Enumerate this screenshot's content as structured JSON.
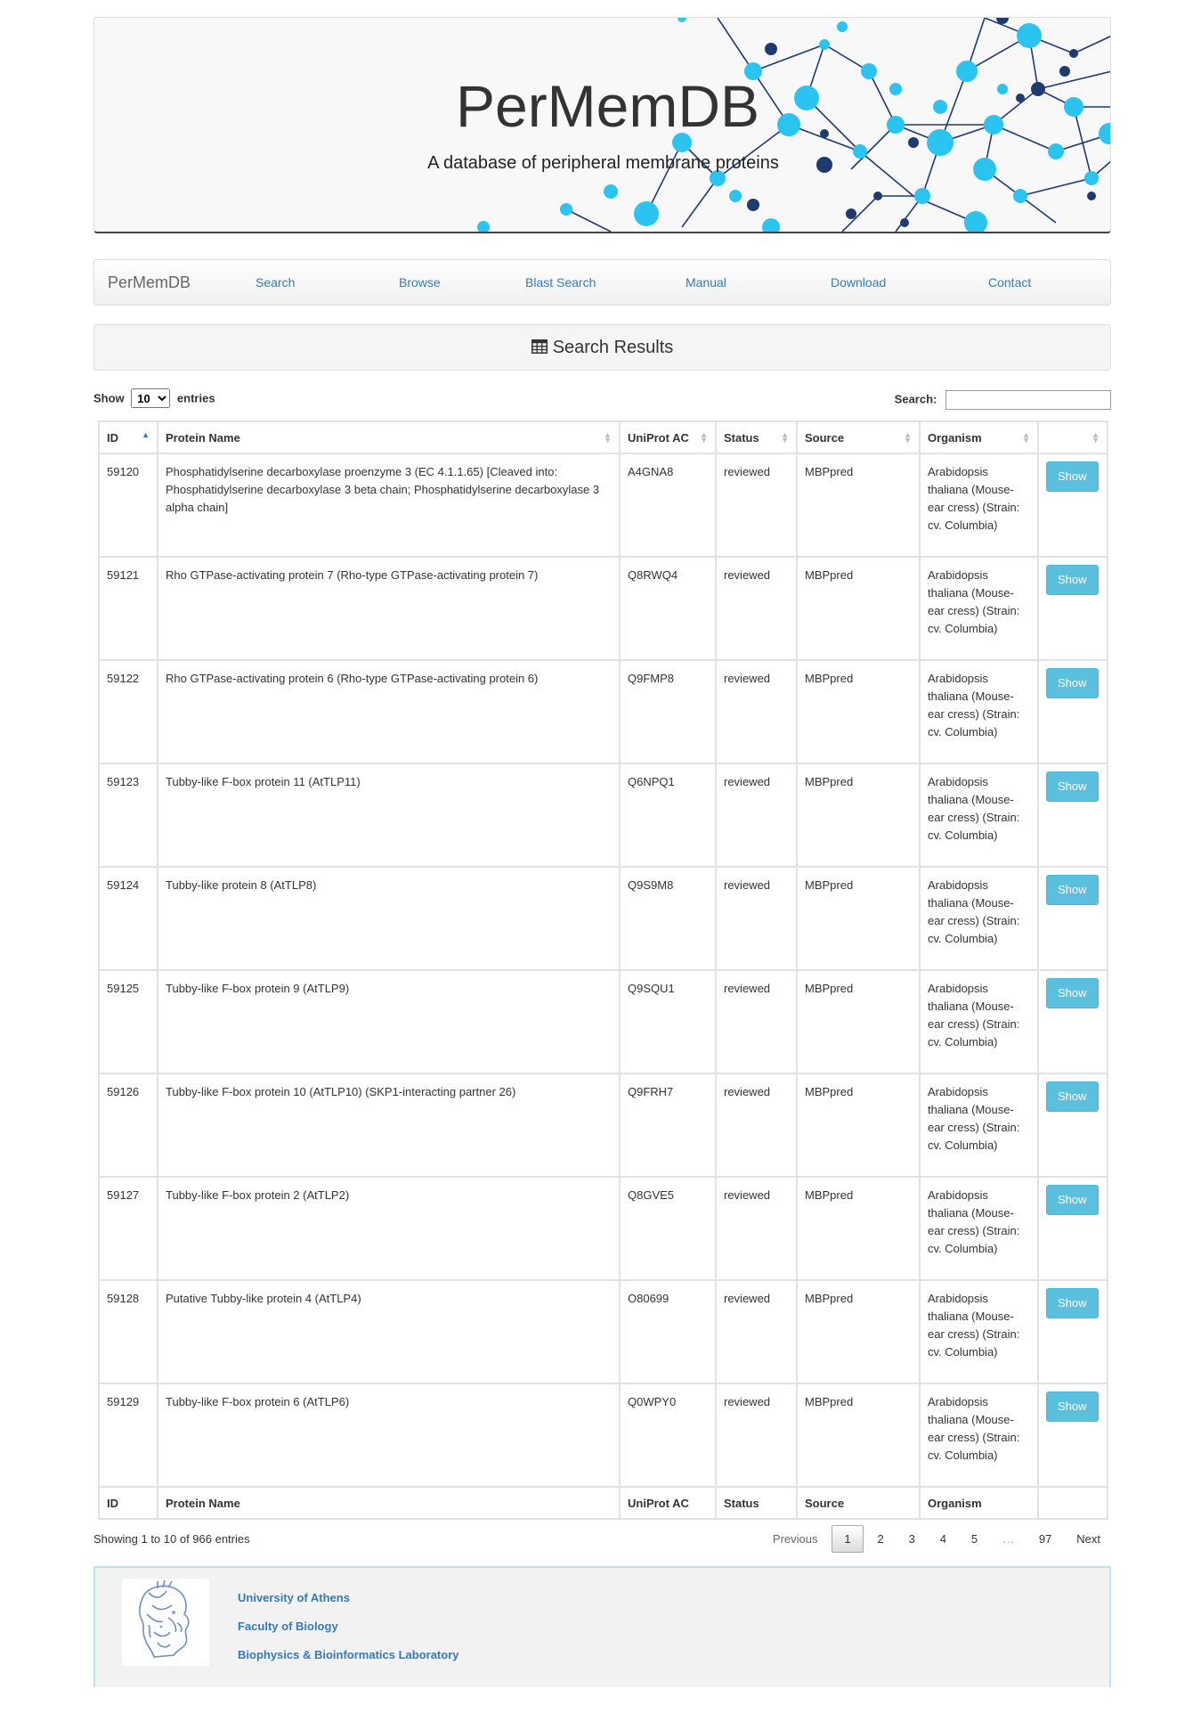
{
  "banner": {
    "title": "PerMemDB",
    "subtitle": "A database of peripheral membrane proteins"
  },
  "nav": {
    "brand": "PerMemDB",
    "items": [
      "Search",
      "Browse",
      "Blast Search",
      "Manual",
      "Download",
      "Contact"
    ]
  },
  "panel": {
    "title": "Search Results",
    "icon": "table-icon"
  },
  "controls": {
    "show_label": "Show",
    "entries_label": "entries",
    "length_value": "10",
    "search_label": "Search:",
    "search_value": ""
  },
  "table": {
    "headers": [
      "ID",
      "Protein Name",
      "UniProt AC",
      "Status",
      "Source",
      "Organism",
      ""
    ],
    "footers": [
      "ID",
      "Protein Name",
      "UniProt AC",
      "Status",
      "Source",
      "Organism",
      ""
    ],
    "button_label": "Show",
    "rows": [
      {
        "id": "59120",
        "name": "Phosphatidylserine decarboxylase proenzyme 3 (EC 4.1.1.65) [Cleaved into: Phosphatidylserine decarboxylase 3 beta chain; Phosphatidylserine decarboxylase 3 alpha chain]",
        "ac": "A4GNA8",
        "status": "reviewed",
        "source": "MBPpred",
        "organism": "Arabidopsis thaliana (Mouse-ear cress) (Strain: cv. Columbia)"
      },
      {
        "id": "59121",
        "name": "Rho GTPase-activating protein 7 (Rho-type GTPase-activating protein 7)",
        "ac": "Q8RWQ4",
        "status": "reviewed",
        "source": "MBPpred",
        "organism": "Arabidopsis thaliana (Mouse-ear cress) (Strain: cv. Columbia)"
      },
      {
        "id": "59122",
        "name": "Rho GTPase-activating protein 6 (Rho-type GTPase-activating protein 6)",
        "ac": "Q9FMP8",
        "status": "reviewed",
        "source": "MBPpred",
        "organism": "Arabidopsis thaliana (Mouse-ear cress) (Strain: cv. Columbia)"
      },
      {
        "id": "59123",
        "name": "Tubby-like F-box protein 11 (AtTLP11)",
        "ac": "Q6NPQ1",
        "status": "reviewed",
        "source": "MBPpred",
        "organism": "Arabidopsis thaliana (Mouse-ear cress) (Strain: cv. Columbia)"
      },
      {
        "id": "59124",
        "name": "Tubby-like protein 8 (AtTLP8)",
        "ac": "Q9S9M8",
        "status": "reviewed",
        "source": "MBPpred",
        "organism": "Arabidopsis thaliana (Mouse-ear cress) (Strain: cv. Columbia)"
      },
      {
        "id": "59125",
        "name": "Tubby-like F-box protein 9 (AtTLP9)",
        "ac": "Q9SQU1",
        "status": "reviewed",
        "source": "MBPpred",
        "organism": "Arabidopsis thaliana (Mouse-ear cress) (Strain: cv. Columbia)"
      },
      {
        "id": "59126",
        "name": "Tubby-like F-box protein 10 (AtTLP10) (SKP1-interacting partner 26)",
        "ac": "Q9FRH7",
        "status": "reviewed",
        "source": "MBPpred",
        "organism": "Arabidopsis thaliana (Mouse-ear cress) (Strain: cv. Columbia)"
      },
      {
        "id": "59127",
        "name": "Tubby-like F-box protein 2 (AtTLP2)",
        "ac": "Q8GVE5",
        "status": "reviewed",
        "source": "MBPpred",
        "organism": "Arabidopsis thaliana (Mouse-ear cress) (Strain: cv. Columbia)"
      },
      {
        "id": "59128",
        "name": "Putative Tubby-like protein 4 (AtTLP4)",
        "ac": "O80699",
        "status": "reviewed",
        "source": "MBPpred",
        "organism": "Arabidopsis thaliana (Mouse-ear cress) (Strain: cv. Columbia)"
      },
      {
        "id": "59129",
        "name": "Tubby-like F-box protein 6 (AtTLP6)",
        "ac": "Q0WPY0",
        "status": "reviewed",
        "source": "MBPpred",
        "organism": "Arabidopsis thaliana (Mouse-ear cress) (Strain: cv. Columbia)"
      }
    ]
  },
  "info": "Showing 1 to 10 of 966 entries",
  "pagination": {
    "previous": "Previous",
    "pages": [
      "1",
      "2",
      "3",
      "4",
      "5",
      "…",
      "97"
    ],
    "current": "1",
    "next": "Next"
  },
  "footer": {
    "logo": "university-athena-logo",
    "links": [
      "University of Athens",
      "Faculty of Biology",
      "Biophysics & Bioinformatics Laboratory"
    ]
  },
  "colors": {
    "link": "#337ab7",
    "button": "#5bc0de",
    "node_light": "#2bc4f0",
    "node_dark": "#1e3a6e"
  }
}
